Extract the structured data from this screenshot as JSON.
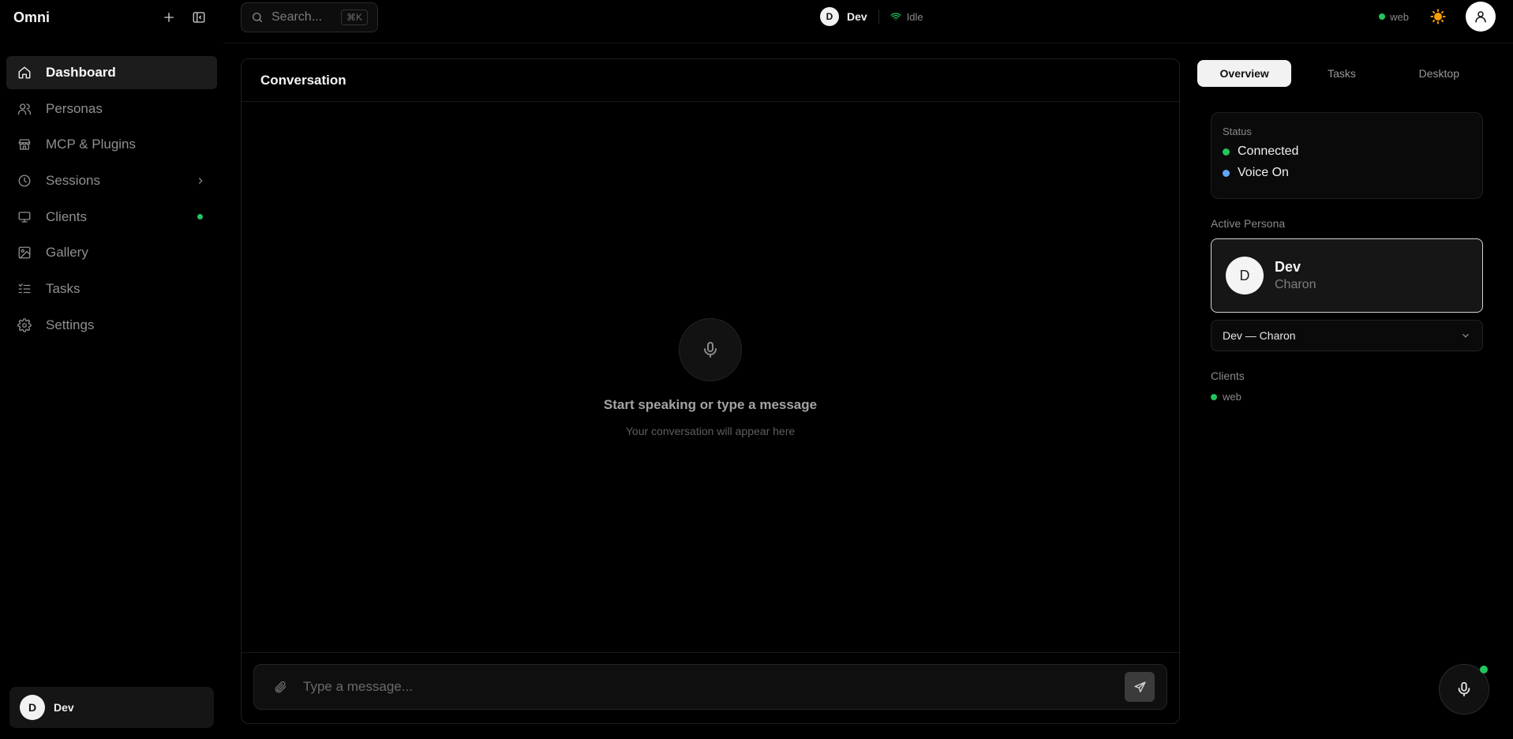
{
  "app": {
    "name": "Omni"
  },
  "sidebar": {
    "items": [
      {
        "label": "Dashboard",
        "icon": "home-icon",
        "active": true
      },
      {
        "label": "Personas",
        "icon": "users-icon"
      },
      {
        "label": "MCP & Plugins",
        "icon": "store-icon"
      },
      {
        "label": "Sessions",
        "icon": "clock-icon",
        "has_submenu": true
      },
      {
        "label": "Clients",
        "icon": "monitor-icon",
        "online": true
      },
      {
        "label": "Gallery",
        "icon": "image-icon"
      },
      {
        "label": "Tasks",
        "icon": "list-todo-icon"
      },
      {
        "label": "Settings",
        "icon": "gear-icon"
      }
    ],
    "user": {
      "initial": "D",
      "name": "Dev"
    }
  },
  "topbar": {
    "search_placeholder": "Search...",
    "search_shortcut": "⌘K",
    "persona_initial": "D",
    "persona_name": "Dev",
    "state": "Idle",
    "client": "web"
  },
  "conversation": {
    "title": "Conversation",
    "empty_title": "Start speaking or type a message",
    "empty_subtitle": "Your conversation will appear here",
    "input_placeholder": "Type a message..."
  },
  "right_panel": {
    "tabs": [
      "Overview",
      "Tasks",
      "Desktop"
    ],
    "active_tab": "Overview",
    "status": {
      "label": "Status",
      "items": [
        {
          "text": "Connected",
          "color": "#22c55e"
        },
        {
          "text": "Voice On",
          "color": "#60a5fa"
        }
      ]
    },
    "active_persona": {
      "label": "Active Persona",
      "initial": "D",
      "name": "Dev",
      "voice": "Charon"
    },
    "persona_select": "Dev — Charon",
    "clients": {
      "label": "Clients",
      "items": [
        "web"
      ]
    }
  },
  "colors": {
    "online": "#22c55e",
    "voice": "#60a5fa",
    "background": "#000000"
  }
}
